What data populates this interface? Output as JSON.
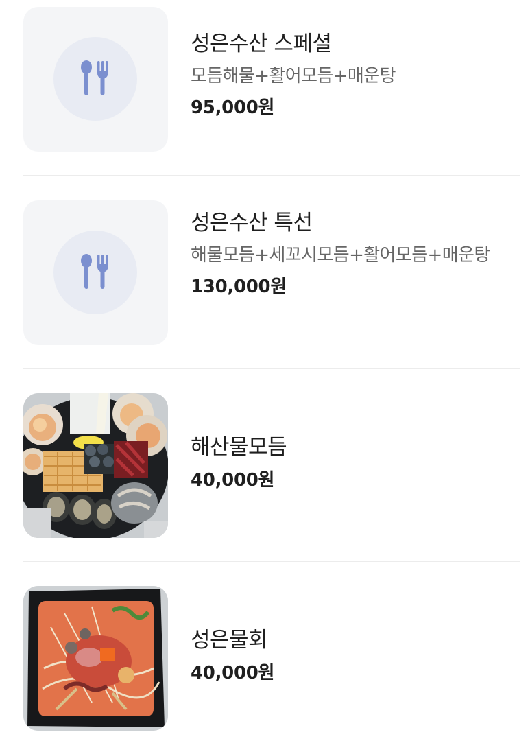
{
  "menu": {
    "items": [
      {
        "name": "성은수산 스페셜",
        "description": "모듬해물+활어모듬+매운탕",
        "price": "95,000원",
        "image": "fork-spoon-placeholder-icon"
      },
      {
        "name": "성은수산 특선",
        "description": "해물모듬+세꼬시모듬+활어모듬+매운탕",
        "price": "130,000원",
        "image": "fork-spoon-placeholder-icon"
      },
      {
        "name": "해산물모듬",
        "price": "40,000원",
        "image": "seafood-platter-photo"
      },
      {
        "name": "성은물회",
        "price": "40,000원",
        "image": "mulhoe-bowl-photo"
      }
    ]
  },
  "colors": {
    "placeholder_bg": "#f4f5f7",
    "placeholder_circle": "#e8ebf3",
    "icon": "#7b8fcf",
    "price_text": "#1f1f1f",
    "desc_text": "#666666"
  }
}
